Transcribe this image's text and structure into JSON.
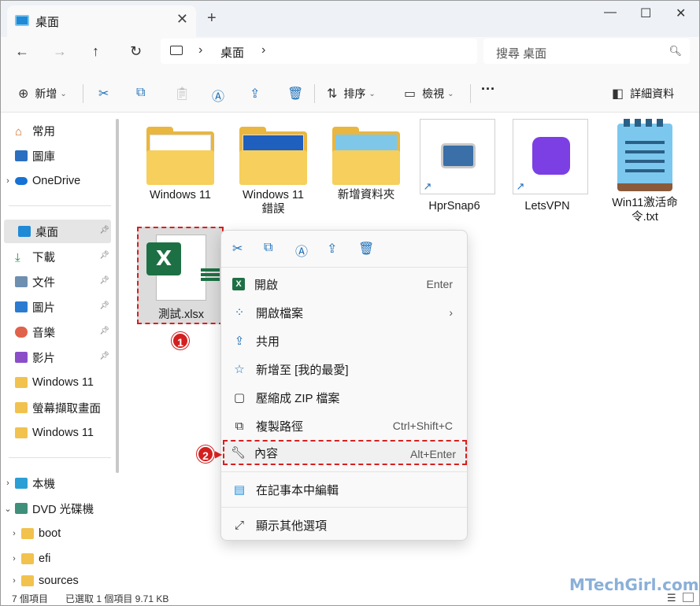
{
  "window": {
    "tab_title": "桌面",
    "close_tab": "✕",
    "new_tab": "+",
    "minimize": "—",
    "maximize": "☐",
    "close": "✕"
  },
  "nav": {
    "back": "←",
    "forward": "→",
    "up": "↑",
    "refresh": "↻",
    "breadcrumb": "桌面",
    "search_placeholder": "搜尋 桌面"
  },
  "toolbar": {
    "new_label": "新增",
    "sort_label": "排序",
    "view_label": "檢視",
    "more": "···",
    "details_label": "詳細資料"
  },
  "sidebar": {
    "items": [
      {
        "label": "常用",
        "pinned": false
      },
      {
        "label": "圖庫",
        "pinned": false
      },
      {
        "label": "OneDrive",
        "pinned": false
      },
      {
        "label": "桌面",
        "pinned": true,
        "selected": true
      },
      {
        "label": "下載",
        "pinned": true
      },
      {
        "label": "文件",
        "pinned": true
      },
      {
        "label": "圖片",
        "pinned": true
      },
      {
        "label": "音樂",
        "pinned": true
      },
      {
        "label": "影片",
        "pinned": true
      },
      {
        "label": "Windows 11",
        "pinned": false
      },
      {
        "label": "螢幕擷取畫面",
        "pinned": false
      },
      {
        "label": "Windows 11",
        "pinned": false
      },
      {
        "label": "本機",
        "pinned": false
      },
      {
        "label": "DVD 光碟機",
        "pinned": false
      },
      {
        "label": "boot",
        "pinned": false
      },
      {
        "label": "efi",
        "pinned": false
      },
      {
        "label": "sources",
        "pinned": false
      }
    ]
  },
  "files": [
    {
      "label": "Windows 11",
      "kind": "folder"
    },
    {
      "label": "Windows 11\n錯誤",
      "kind": "folder"
    },
    {
      "label": "新增資料夾",
      "kind": "folder"
    },
    {
      "label": "HprSnap6",
      "kind": "shortcut"
    },
    {
      "label": "LetsVPN",
      "kind": "shortcut"
    },
    {
      "label": "Win11激活命\n令.txt",
      "kind": "text"
    }
  ],
  "selected_file": {
    "label": "測試.xlsx",
    "icon_letter": "X"
  },
  "badges": {
    "one": "1",
    "two": "2"
  },
  "context_menu": {
    "items": [
      {
        "label": "開啟",
        "shortcut": "Enter"
      },
      {
        "label": "開啟檔案",
        "shortcut": "›"
      },
      {
        "label": "共用",
        "shortcut": ""
      },
      {
        "label": "新增至 [我的最愛]",
        "shortcut": ""
      },
      {
        "label": "壓縮成 ZIP 檔案",
        "shortcut": ""
      },
      {
        "label": "複製路徑",
        "shortcut": "Ctrl+Shift+C"
      },
      {
        "label": "內容",
        "shortcut": "Alt+Enter"
      },
      {
        "label": "在記事本中編輯",
        "shortcut": ""
      },
      {
        "label": "顯示其他選項",
        "shortcut": ""
      }
    ]
  },
  "status": {
    "count": "7 個項目",
    "selection": "已選取 1 個項目  9.71 KB"
  },
  "watermark": "MTechGirl.com",
  "colors": {
    "accent": "#1d6fb8",
    "highlight": "#d81e1e",
    "excel": "#1d7044",
    "folder": "#f6cf5c"
  }
}
